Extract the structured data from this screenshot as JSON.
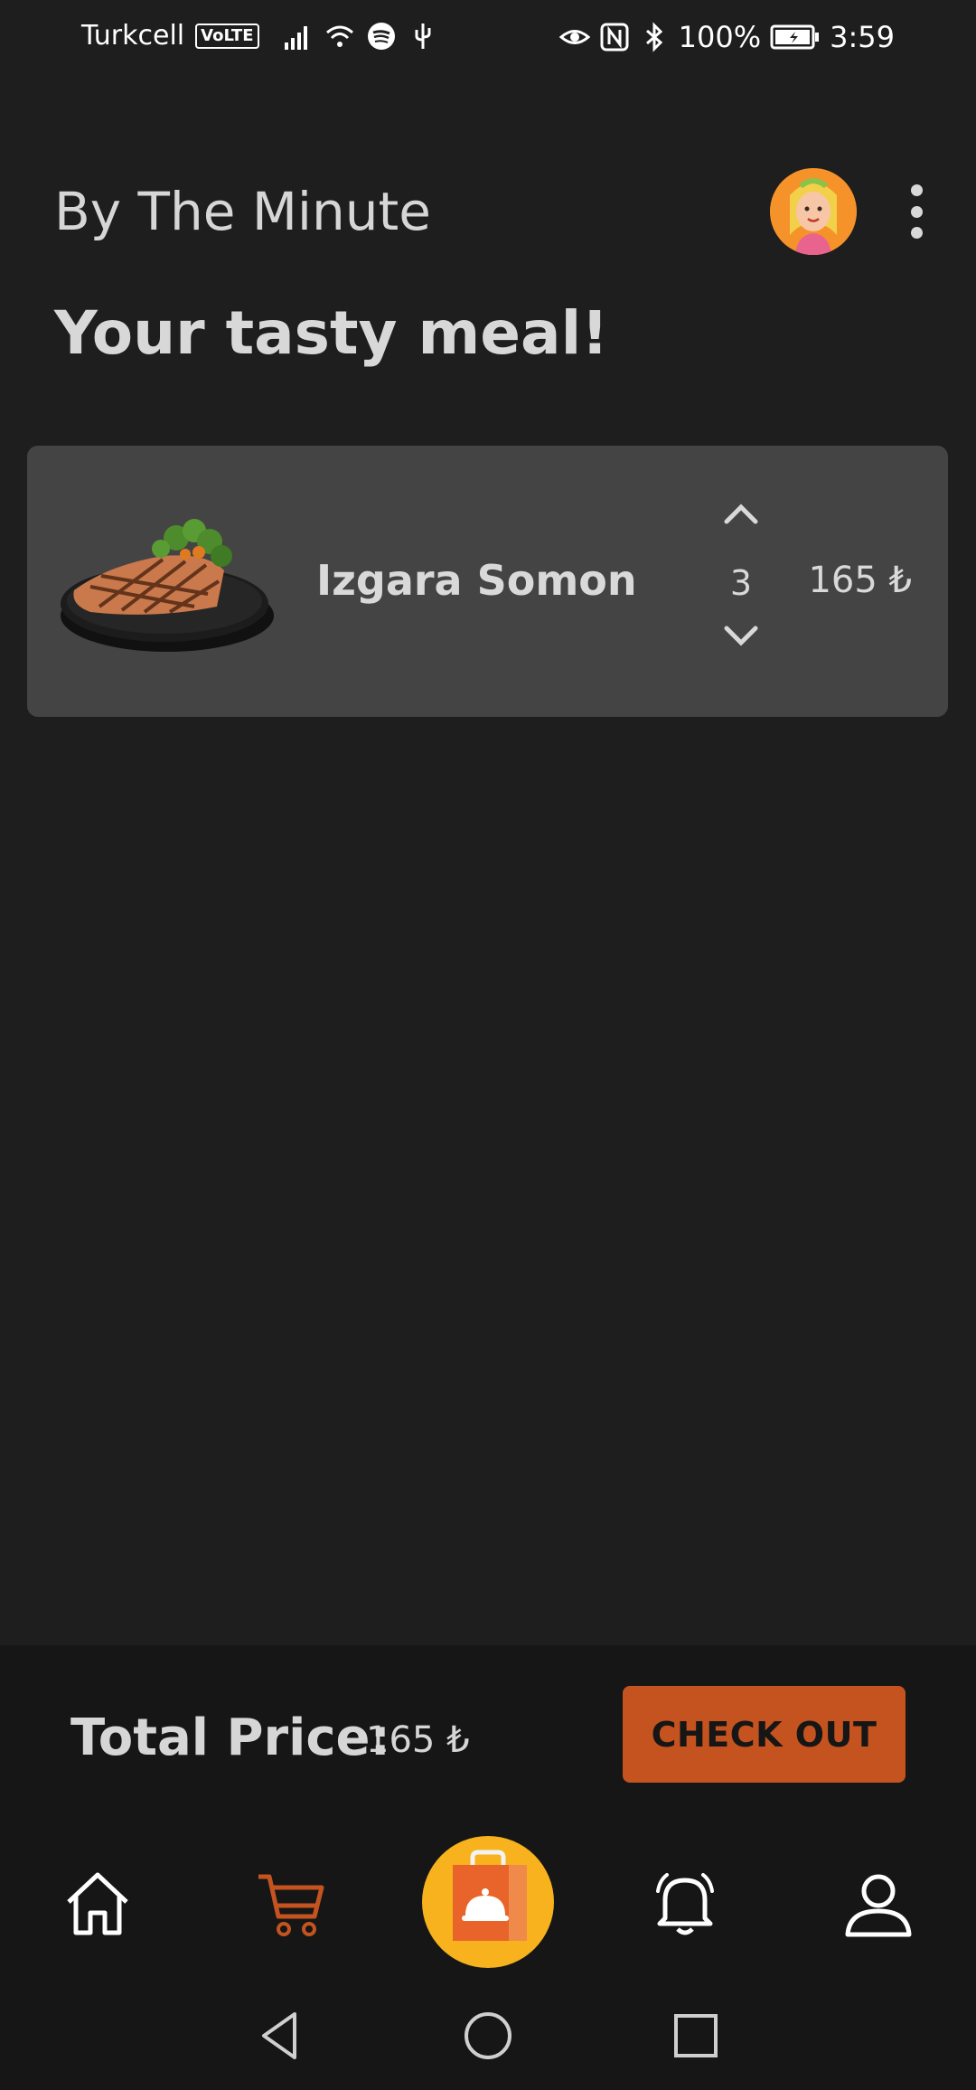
{
  "status_bar": {
    "carrier": "Turkcell",
    "volte": "VoLTE",
    "battery": "100%",
    "time": "3:59"
  },
  "header": {
    "title": "By The Minute"
  },
  "page": {
    "heading": "Your tasty meal!"
  },
  "cart": {
    "items": [
      {
        "name": "Izgara Somon",
        "quantity": "3",
        "price": "165 ₺"
      }
    ]
  },
  "summary": {
    "total_label": "Total Price:",
    "total_value": "165 ₺",
    "checkout_label": "CHECK OUT"
  },
  "icons": [
    "eye-icon",
    "nfc-icon",
    "bluetooth-icon",
    "battery-icon",
    "wifi-icon",
    "signal-icon",
    "spotify-icon",
    "usb-icon",
    "home-icon",
    "cart-icon",
    "food-bag-icon",
    "bell-icon",
    "profile-icon",
    "back-icon",
    "home-circle-icon",
    "recent-apps-icon"
  ],
  "colors": {
    "background": "#1e1e1e",
    "card": "#444444",
    "accent": "#c4531f",
    "center_button": "#f7b21d"
  }
}
